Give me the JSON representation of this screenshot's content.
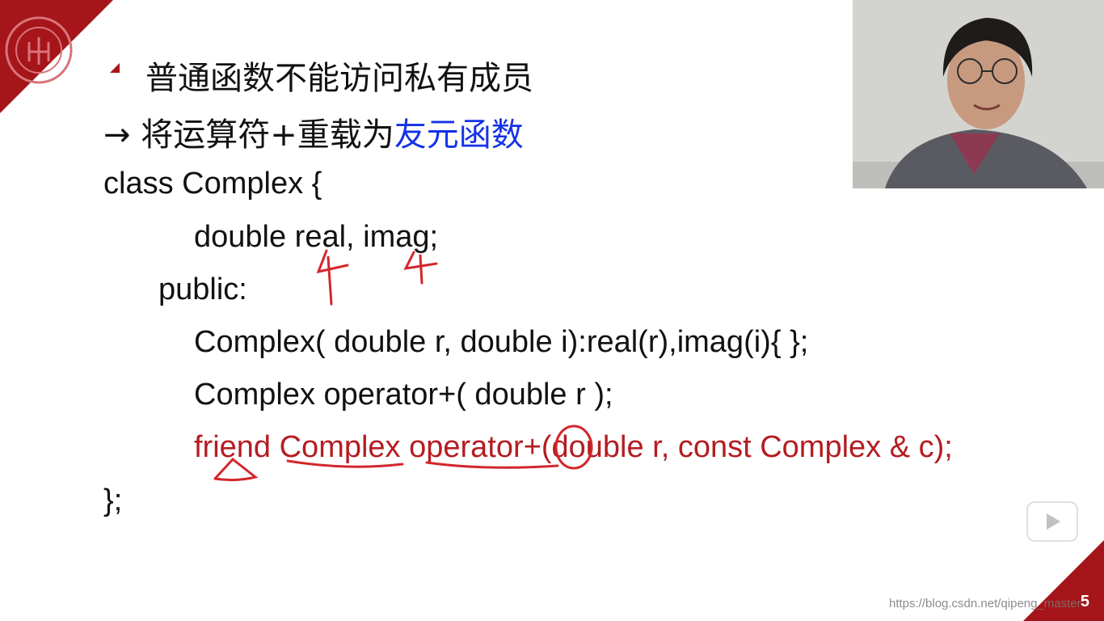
{
  "slide": {
    "number": "5",
    "bullet_text": "普通函数不能访问私有成员",
    "arrow_glyph": "→",
    "arrow_text": "将运算符+重载为",
    "arrow_highlight": "友元函数",
    "code": {
      "line1": "class Complex {",
      "line2": "double real, imag;",
      "line3": "public:",
      "line4": "Complex( double r, double i):real(r),imag(i){ };",
      "line5": "Complex operator+( double r );",
      "line6": "friend Complex operator+(double r, const Complex & c);",
      "line7": "};"
    }
  },
  "overlay": {
    "play_icon": "play-icon",
    "watermark": "https://blog.csdn.net/qipeng_master"
  },
  "colors": {
    "brand_red": "#a5151a",
    "highlight_blue": "#1432e6",
    "friend_red": "#b41d22"
  }
}
